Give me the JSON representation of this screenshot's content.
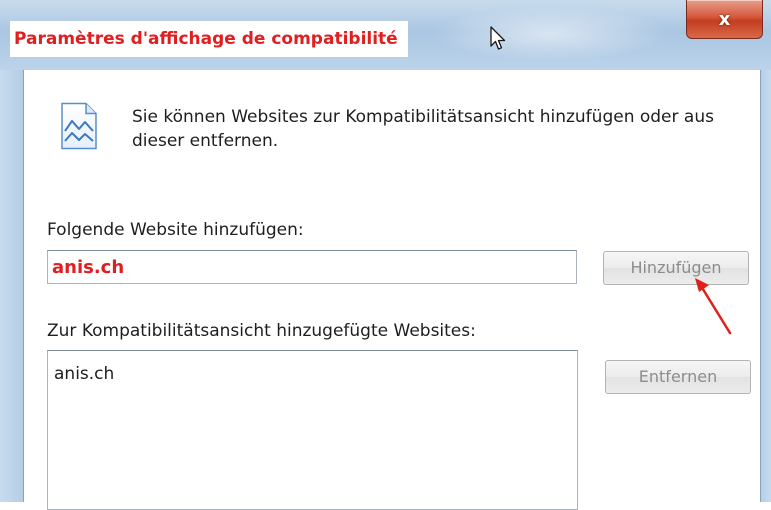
{
  "window": {
    "title": "Paramètres d'affichage de compatibilité",
    "close_glyph": "x"
  },
  "dialog": {
    "icon": "compatibility-view-icon",
    "info_text": "Sie können Websites zur Kompatibilitätsansicht hinzufügen oder aus dieser entfernen.",
    "add_label": "Folgende Website hinzufügen:",
    "add_input_value": "anis.ch",
    "add_button": "Hinzufügen",
    "list_label": "Zur Kompatibilitätsansicht hinzugefügte Websites:",
    "sites": [
      "anis.ch"
    ],
    "remove_button": "Entfernen"
  },
  "colors": {
    "title_text": "#e02020",
    "input_text": "#e02020",
    "annotation_arrow": "#e0201a",
    "close_button": "#c74a2d"
  }
}
